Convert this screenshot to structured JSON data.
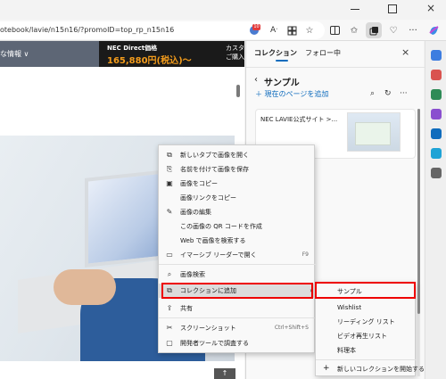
{
  "browser": {
    "url": "otebook/lavie/n15n16/?promoID=top_rp_n15n16",
    "window_close_icon": "×",
    "extension_badge": "10"
  },
  "page": {
    "nav_text": "な情報 ∨",
    "promo_title": "NEC Direct価格",
    "promo_price": "165,880円(税込)～",
    "promo_right_1": "カスタマイズ",
    "promo_right_2": "ご購入はこ",
    "scroll_arrow": "↑"
  },
  "panel": {
    "tabs": [
      {
        "label": "コレクション",
        "active": true
      },
      {
        "label": "フォロー中",
        "active": false
      }
    ],
    "close_icon": "×",
    "back_icon": "‹",
    "collection_title": "サンプル",
    "add_page_label": "＋ 現在のページを追加",
    "card_title": "NEC LAVIE公式サイト >..."
  },
  "context_menu": {
    "items": [
      {
        "icon": "new-tab-icon",
        "glyph": "⧉",
        "label": "新しいタブで画像を開く"
      },
      {
        "icon": "save-image-icon",
        "glyph": "⎘",
        "label": "名前を付けて画像を保存"
      },
      {
        "icon": "copy-image-icon",
        "glyph": "▣",
        "label": "画像をコピー"
      },
      {
        "icon": "",
        "glyph": "",
        "label": "画像リンクをコピー"
      },
      {
        "icon": "edit-image-icon",
        "glyph": "✎",
        "label": "画像の編集"
      },
      {
        "icon": "",
        "glyph": "",
        "label": "この画像の QR コードを作成"
      },
      {
        "icon": "",
        "glyph": "",
        "label": "Web で画像を検索する"
      },
      {
        "icon": "immersive-reader-icon",
        "glyph": "▭",
        "label": "イマーシブ リーダーで開く",
        "shortcut": "F9"
      },
      {
        "icon": "visual-search-icon",
        "glyph": "⌕",
        "label": "画像検索"
      },
      {
        "icon": "add-to-collection-icon",
        "glyph": "⧉",
        "label": "コレクションに追加",
        "submenu": true
      },
      {
        "icon": "share-icon",
        "glyph": "⇪",
        "label": "共有"
      },
      {
        "icon": "screenshot-icon",
        "glyph": "✂",
        "label": "スクリーンショット",
        "shortcut": "Ctrl+Shift+S"
      },
      {
        "icon": "devtools-icon",
        "glyph": "▢",
        "label": "開発者ツールで調査する"
      }
    ],
    "submenu_arrow": "›"
  },
  "submenu": {
    "items": [
      "サンプル",
      "Wishlist",
      "リーディング リスト",
      "ビデオ再生リスト",
      "料理本"
    ],
    "new_collection_icon": "+",
    "new_collection_label": "新しいコレクションを開始する"
  },
  "colors": {
    "accent": "#0f6cbd",
    "highlight_box": "#e00000",
    "promo_price": "#f39c1c"
  }
}
